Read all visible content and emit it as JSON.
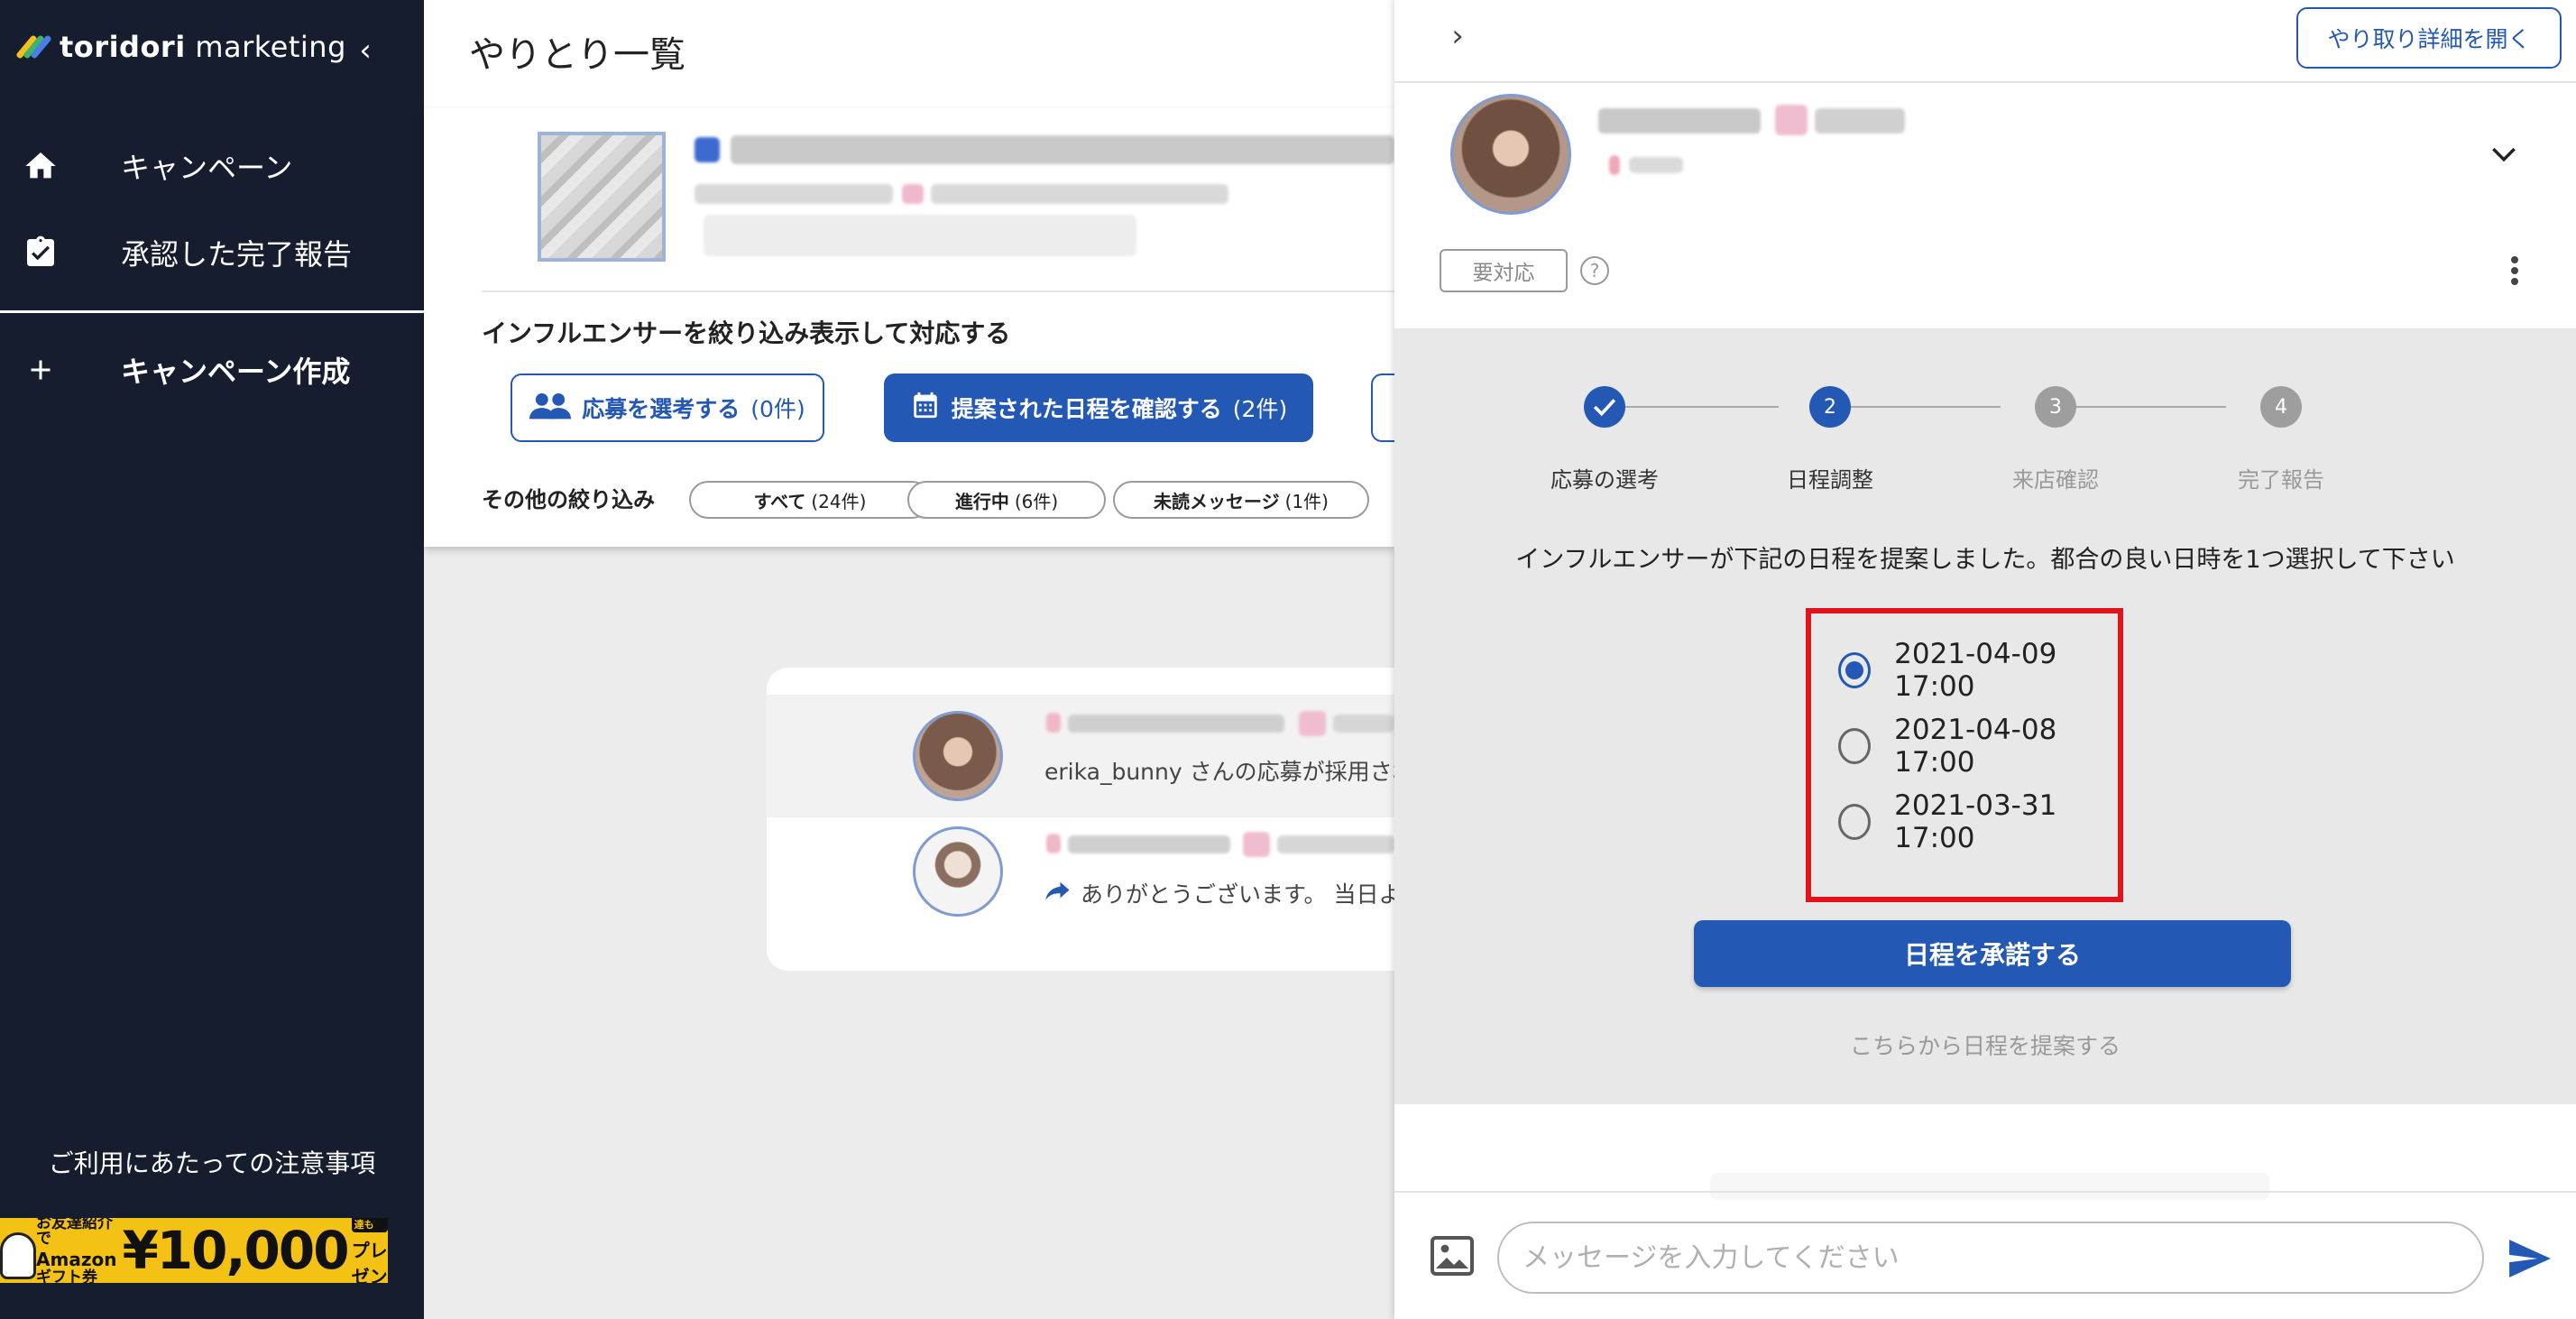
{
  "sidebar": {
    "logo_bold": "toridori",
    "logo_light": " marketing",
    "nav": [
      {
        "label": "キャンペーン",
        "icon": "home-icon"
      },
      {
        "label": "承認した完了報告",
        "icon": "clipboard-check-icon"
      },
      {
        "label": "キャンペーン作成",
        "icon": "plus-icon"
      }
    ],
    "notice": "ご利用にあたっての注意事項",
    "banner": {
      "line1": "お友達紹介で",
      "line2": "Amazon",
      "line3": "ギフト券",
      "amount": "¥10,000",
      "tag": "あなたもお友達も",
      "suffix": "プレゼント"
    }
  },
  "main": {
    "title": "やりとり一覧",
    "filter_heading": "インフルエンサーを絞り込み表示して対応する",
    "filter_buttons": [
      {
        "label": "応募を選考する",
        "count": "(0件)",
        "icon": "people-icon"
      },
      {
        "label": "提案された日程を確認する",
        "count": "(2件)",
        "icon": "calendar-icon"
      }
    ],
    "other_label": "その他の絞り込み",
    "chips": [
      {
        "label": "すべて",
        "count": "(24件)"
      },
      {
        "label": "進行中",
        "count": "(6件)"
      },
      {
        "label": "未読メッセージ",
        "count": "(1件)"
      }
    ],
    "messages": [
      {
        "preview": "erika_bunny さんの応募が採用され"
      },
      {
        "preview": "ありがとうございます。 当日よ"
      }
    ]
  },
  "panel": {
    "open_details": "やり取り詳細を開く",
    "status_tag": "要対応",
    "steps": [
      {
        "label": "応募の選考",
        "num": "1",
        "state": "done"
      },
      {
        "label": "日程調整",
        "num": "2",
        "state": "active"
      },
      {
        "label": "来店確認",
        "num": "3",
        "state": "todo"
      },
      {
        "label": "完了報告",
        "num": "4",
        "state": "todo"
      }
    ],
    "instruction": "インフルエンサーが下記の日程を提案しました。都合の良い日時を1つ選択して下さい",
    "dates": [
      {
        "value": "2021-04-09 17:00",
        "selected": true
      },
      {
        "value": "2021-04-08 17:00",
        "selected": false
      },
      {
        "value": "2021-03-31 17:00",
        "selected": false
      }
    ],
    "accept_label": "日程を承諾する",
    "propose_label": "こちらから日程を提案する",
    "message_placeholder": "メッセージを入力してください"
  },
  "colors": {
    "sidebar_bg": "#161d2e",
    "accent": "#2458b5",
    "highlight_box": "#e0141c",
    "panel_gray": "#e8e8e8"
  }
}
